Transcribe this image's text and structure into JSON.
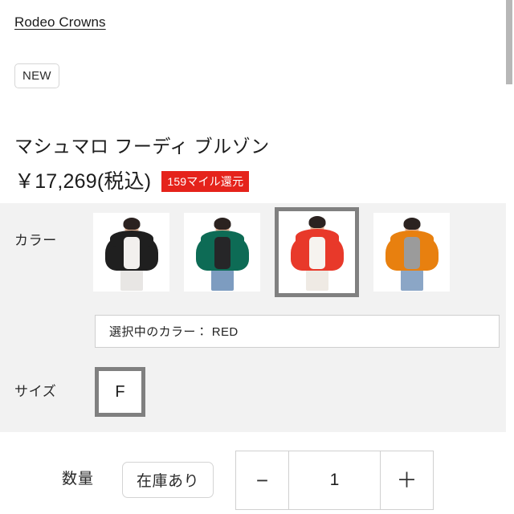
{
  "brand": {
    "name": "Rodeo Crowns"
  },
  "badges": {
    "new_label": "NEW",
    "mile_label": "159マイル還元",
    "mile_color": "#e5231b"
  },
  "product": {
    "title": "マシュマロ フーディ ブルゾン",
    "price": "￥17,269(税込)"
  },
  "color_section": {
    "label": "カラー",
    "selected_text": "選択中のカラー： RED",
    "swatches": [
      {
        "name": "BLACK",
        "hex": "#1f1f1f",
        "pants": "#e8e6e4",
        "inner": "#f2f0ee",
        "selected": false
      },
      {
        "name": "GREEN",
        "hex": "#0d6b55",
        "pants": "#7d9cc0",
        "inner": "#262628",
        "selected": false
      },
      {
        "name": "RED",
        "hex": "#e8392a",
        "pants": "#efeae4",
        "inner": "#f6f3ef",
        "selected": true
      },
      {
        "name": "ORANGE",
        "hex": "#e8800f",
        "pants": "#8ba6c6",
        "inner": "#9b9b9b",
        "selected": false
      }
    ]
  },
  "size_section": {
    "label": "サイズ",
    "options": [
      {
        "label": "F",
        "selected": true
      }
    ]
  },
  "quantity_section": {
    "label": "数量",
    "stock_label": "在庫あり",
    "decrement_label": "−",
    "value": "1",
    "increment_label": "＋"
  },
  "scrollbar": {
    "thumb_color": "#b7b7b7"
  }
}
